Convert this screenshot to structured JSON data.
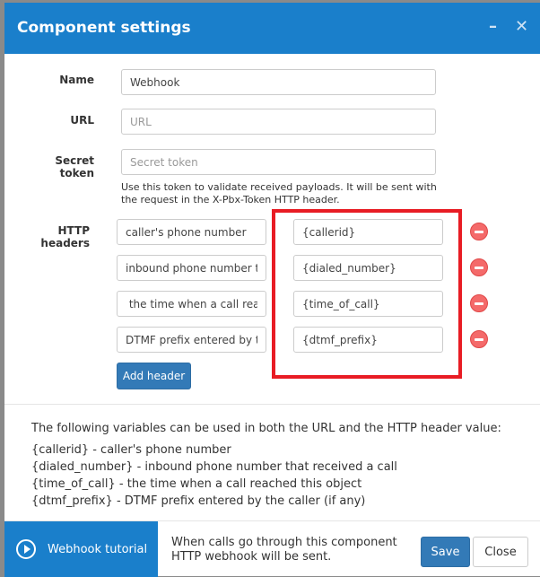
{
  "dialog": {
    "title": "Component settings",
    "minimize_icon": "minimize-icon",
    "close_icon": "close-icon"
  },
  "form": {
    "name_label": "Name",
    "name_value": "Webhook",
    "url_label": "URL",
    "url_placeholder": "URL",
    "secret_label_1": "Secret",
    "secret_label_2": "token",
    "secret_placeholder": "Secret token",
    "secret_help": "Use this token to validate received payloads. It will be sent with the request in the X-Pbx-Token HTTP header.",
    "headers_label_1": "HTTP",
    "headers_label_2": "headers",
    "headers": [
      {
        "name": "caller's phone number",
        "value": "{callerid}"
      },
      {
        "name": "inbound phone number that received a call",
        "value": "{dialed_number}"
      },
      {
        "name": " the time when a call reached this object",
        "value": "{time_of_call}"
      },
      {
        "name": "DTMF prefix entered by the caller",
        "value": "{dtmf_prefix}"
      }
    ],
    "add_header": "Add header",
    "highlight_color": "#e81c24"
  },
  "variables": {
    "intro": "The following variables can be used in both the URL and the HTTP header value:",
    "items": [
      "{callerid} - caller's phone number",
      "{dialed_number} - inbound phone number that received a call",
      "{time_of_call} - the time when a call reached this object",
      "{dtmf_prefix} - DTMF prefix entered by the caller (if any)"
    ]
  },
  "footer": {
    "tutorial": "Webhook tutorial",
    "message_1": "When calls go through this component",
    "message_2": "HTTP webhook will be sent.",
    "save": "Save",
    "close": "Close"
  },
  "colors": {
    "header": "#1a7fcb",
    "primary": "#337ab7",
    "remove": "#f46a6a"
  }
}
